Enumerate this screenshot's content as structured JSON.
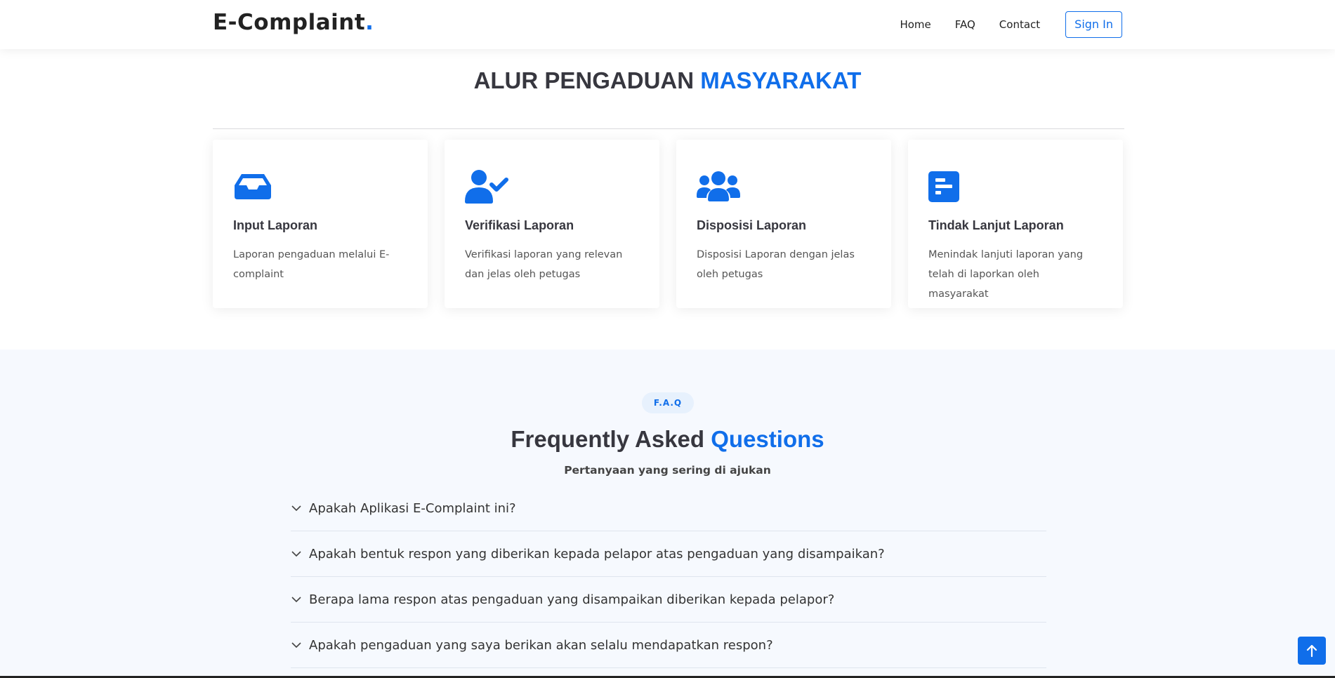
{
  "header": {
    "logo_text": "E-Complaint",
    "logo_dot": ".",
    "nav": [
      "Home",
      "FAQ",
      "Contact"
    ],
    "signin_label": "Sign In"
  },
  "alur": {
    "title_main": "ALUR PENGADUAN",
    "title_highlight": "MASYARAKAT",
    "cards": [
      {
        "icon": "inbox-icon",
        "title": "Input Laporan",
        "text": "Laporan pengaduan melalui E-complaint"
      },
      {
        "icon": "user-check-icon",
        "title": "Verifikasi Laporan",
        "text": "Verifikasi laporan yang relevan dan jelas oleh petugas"
      },
      {
        "icon": "users-icon",
        "title": "Disposisi Laporan",
        "text": "Disposisi Laporan dengan jelas oleh petugas"
      },
      {
        "icon": "document-icon",
        "title": "Tindak Lanjut Laporan",
        "text": "Menindak lanjuti laporan yang telah di laporkan oleh masyarakat"
      }
    ]
  },
  "faq": {
    "badge": "F.A.Q",
    "title_main": "Frequently Asked",
    "title_highlight": "Questions",
    "subtitle": "Pertanyaan yang sering di ajukan",
    "items": [
      "Apakah Aplikasi E-Complaint ini?",
      "Apakah bentuk respon yang diberikan kepada pelapor atas pengaduan yang disampaikan?",
      "Berapa lama respon atas pengaduan yang disampaikan diberikan kepada pelapor?",
      "Apakah pengaduan yang saya berikan akan selalu mendapatkan respon?"
    ]
  },
  "colors": {
    "accent": "#106eea",
    "text": "#37373f",
    "faq_bg": "#f6f9fe"
  }
}
